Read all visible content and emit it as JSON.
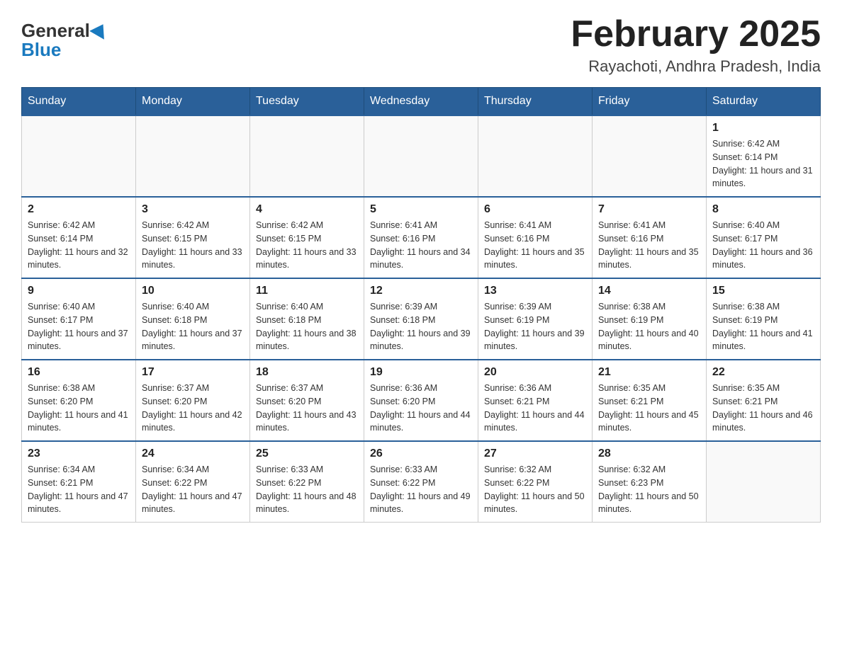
{
  "header": {
    "logo": {
      "general": "General",
      "blue": "Blue"
    },
    "title": "February 2025",
    "location": "Rayachoti, Andhra Pradesh, India"
  },
  "weekdays": [
    "Sunday",
    "Monday",
    "Tuesday",
    "Wednesday",
    "Thursday",
    "Friday",
    "Saturday"
  ],
  "weeks": [
    [
      {
        "day": "",
        "info": ""
      },
      {
        "day": "",
        "info": ""
      },
      {
        "day": "",
        "info": ""
      },
      {
        "day": "",
        "info": ""
      },
      {
        "day": "",
        "info": ""
      },
      {
        "day": "",
        "info": ""
      },
      {
        "day": "1",
        "info": "Sunrise: 6:42 AM\nSunset: 6:14 PM\nDaylight: 11 hours and 31 minutes."
      }
    ],
    [
      {
        "day": "2",
        "info": "Sunrise: 6:42 AM\nSunset: 6:14 PM\nDaylight: 11 hours and 32 minutes."
      },
      {
        "day": "3",
        "info": "Sunrise: 6:42 AM\nSunset: 6:15 PM\nDaylight: 11 hours and 33 minutes."
      },
      {
        "day": "4",
        "info": "Sunrise: 6:42 AM\nSunset: 6:15 PM\nDaylight: 11 hours and 33 minutes."
      },
      {
        "day": "5",
        "info": "Sunrise: 6:41 AM\nSunset: 6:16 PM\nDaylight: 11 hours and 34 minutes."
      },
      {
        "day": "6",
        "info": "Sunrise: 6:41 AM\nSunset: 6:16 PM\nDaylight: 11 hours and 35 minutes."
      },
      {
        "day": "7",
        "info": "Sunrise: 6:41 AM\nSunset: 6:16 PM\nDaylight: 11 hours and 35 minutes."
      },
      {
        "day": "8",
        "info": "Sunrise: 6:40 AM\nSunset: 6:17 PM\nDaylight: 11 hours and 36 minutes."
      }
    ],
    [
      {
        "day": "9",
        "info": "Sunrise: 6:40 AM\nSunset: 6:17 PM\nDaylight: 11 hours and 37 minutes."
      },
      {
        "day": "10",
        "info": "Sunrise: 6:40 AM\nSunset: 6:18 PM\nDaylight: 11 hours and 37 minutes."
      },
      {
        "day": "11",
        "info": "Sunrise: 6:40 AM\nSunset: 6:18 PM\nDaylight: 11 hours and 38 minutes."
      },
      {
        "day": "12",
        "info": "Sunrise: 6:39 AM\nSunset: 6:18 PM\nDaylight: 11 hours and 39 minutes."
      },
      {
        "day": "13",
        "info": "Sunrise: 6:39 AM\nSunset: 6:19 PM\nDaylight: 11 hours and 39 minutes."
      },
      {
        "day": "14",
        "info": "Sunrise: 6:38 AM\nSunset: 6:19 PM\nDaylight: 11 hours and 40 minutes."
      },
      {
        "day": "15",
        "info": "Sunrise: 6:38 AM\nSunset: 6:19 PM\nDaylight: 11 hours and 41 minutes."
      }
    ],
    [
      {
        "day": "16",
        "info": "Sunrise: 6:38 AM\nSunset: 6:20 PM\nDaylight: 11 hours and 41 minutes."
      },
      {
        "day": "17",
        "info": "Sunrise: 6:37 AM\nSunset: 6:20 PM\nDaylight: 11 hours and 42 minutes."
      },
      {
        "day": "18",
        "info": "Sunrise: 6:37 AM\nSunset: 6:20 PM\nDaylight: 11 hours and 43 minutes."
      },
      {
        "day": "19",
        "info": "Sunrise: 6:36 AM\nSunset: 6:20 PM\nDaylight: 11 hours and 44 minutes."
      },
      {
        "day": "20",
        "info": "Sunrise: 6:36 AM\nSunset: 6:21 PM\nDaylight: 11 hours and 44 minutes."
      },
      {
        "day": "21",
        "info": "Sunrise: 6:35 AM\nSunset: 6:21 PM\nDaylight: 11 hours and 45 minutes."
      },
      {
        "day": "22",
        "info": "Sunrise: 6:35 AM\nSunset: 6:21 PM\nDaylight: 11 hours and 46 minutes."
      }
    ],
    [
      {
        "day": "23",
        "info": "Sunrise: 6:34 AM\nSunset: 6:21 PM\nDaylight: 11 hours and 47 minutes."
      },
      {
        "day": "24",
        "info": "Sunrise: 6:34 AM\nSunset: 6:22 PM\nDaylight: 11 hours and 47 minutes."
      },
      {
        "day": "25",
        "info": "Sunrise: 6:33 AM\nSunset: 6:22 PM\nDaylight: 11 hours and 48 minutes."
      },
      {
        "day": "26",
        "info": "Sunrise: 6:33 AM\nSunset: 6:22 PM\nDaylight: 11 hours and 49 minutes."
      },
      {
        "day": "27",
        "info": "Sunrise: 6:32 AM\nSunset: 6:22 PM\nDaylight: 11 hours and 50 minutes."
      },
      {
        "day": "28",
        "info": "Sunrise: 6:32 AM\nSunset: 6:23 PM\nDaylight: 11 hours and 50 minutes."
      },
      {
        "day": "",
        "info": ""
      }
    ]
  ]
}
